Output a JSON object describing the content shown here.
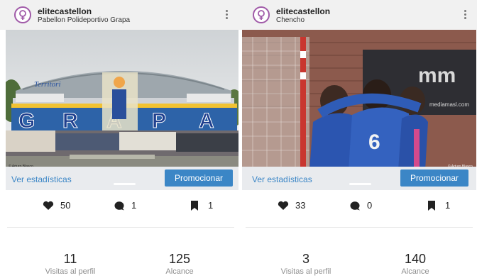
{
  "posts": [
    {
      "username": "elitecastellon",
      "location": "Pabellon Polideportivo Grapa",
      "stats_link": "Ver estadísticas",
      "promote_button": "Promocionar",
      "likes": "50",
      "comments": "1",
      "saves": "1",
      "profile_visits": "11",
      "profile_visits_label": "Visitas al perfil",
      "reach": "125",
      "reach_label": "Alcance",
      "photo_lettering": "GRAPA",
      "photo_small_text": "Territori",
      "photo_credit": "© Arturo Blasco"
    },
    {
      "username": "elitecastellon",
      "location": "Chencho",
      "stats_link": "Ver estadísticas",
      "promote_button": "Promocionar",
      "likes": "33",
      "comments": "0",
      "saves": "1",
      "profile_visits": "3",
      "profile_visits_label": "Visitas al perfil",
      "reach": "140",
      "reach_label": "Alcance",
      "photo_jersey_number": "6",
      "photo_banner_text": "mediamasl.com",
      "photo_credit": "© Arturo Blasco"
    }
  ],
  "icons": {
    "avatar": "venus-symbol-icon",
    "menu": "kebab-menu-icon",
    "likes": "heart-icon",
    "comments": "comment-bubble-icon",
    "saves": "bookmark-icon"
  },
  "colors": {
    "link": "#3b86c6",
    "promote_bg": "#3b86c6",
    "avatar_ring": "#a05aa8"
  }
}
